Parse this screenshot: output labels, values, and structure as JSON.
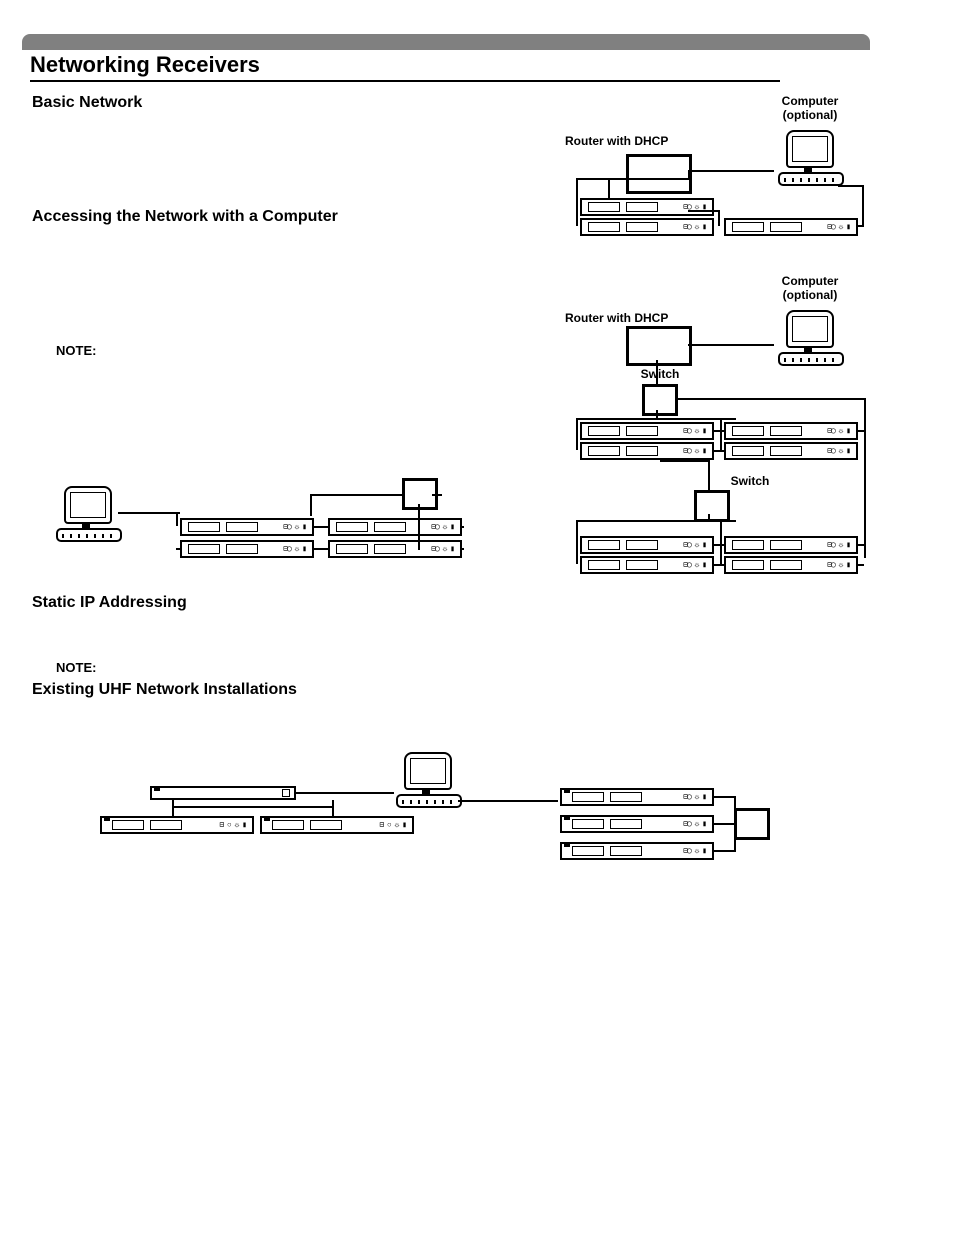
{
  "title": "Networking Receivers",
  "sections": {
    "basic": "Basic Network",
    "accessing": "Accessing the Network with a Computer",
    "static": "Static IP Addressing",
    "uhf": "Existing UHF Network Installations"
  },
  "labels": {
    "note": "NOTE:",
    "computer_optional": "Computer (optional)",
    "router": "Router with DHCP",
    "switch": "Switch"
  }
}
